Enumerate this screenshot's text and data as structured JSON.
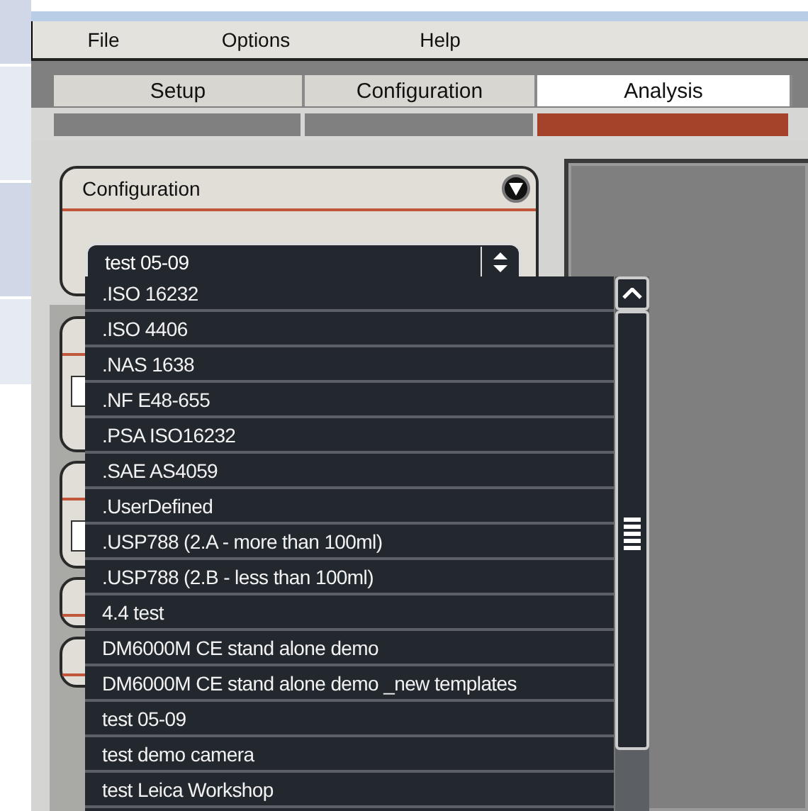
{
  "menu": [
    "File",
    "Options",
    "Help"
  ],
  "tabs": [
    {
      "label": "Setup",
      "selected": false
    },
    {
      "label": "Configuration",
      "selected": false
    },
    {
      "label": "Analysis",
      "selected": true
    }
  ],
  "configuration_panel": {
    "title": "Configuration",
    "select": {
      "value": "test 05-09"
    }
  },
  "dropdown": {
    "items": [
      ".ISO 16232",
      ".ISO 4406",
      ".NAS 1638",
      ".NF E48-655",
      ".PSA ISO16232",
      ".SAE AS4059",
      ".UserDefined",
      ".USP788 (2.A - more than 100ml)",
      ".USP788 (2.B - less than 100ml)",
      "4.4 test",
      "DM6000M CE stand alone demo",
      "DM6000M CE stand alone demo _new templates",
      "test 05-09",
      "test demo camera",
      "test Leica Workshop"
    ]
  }
}
